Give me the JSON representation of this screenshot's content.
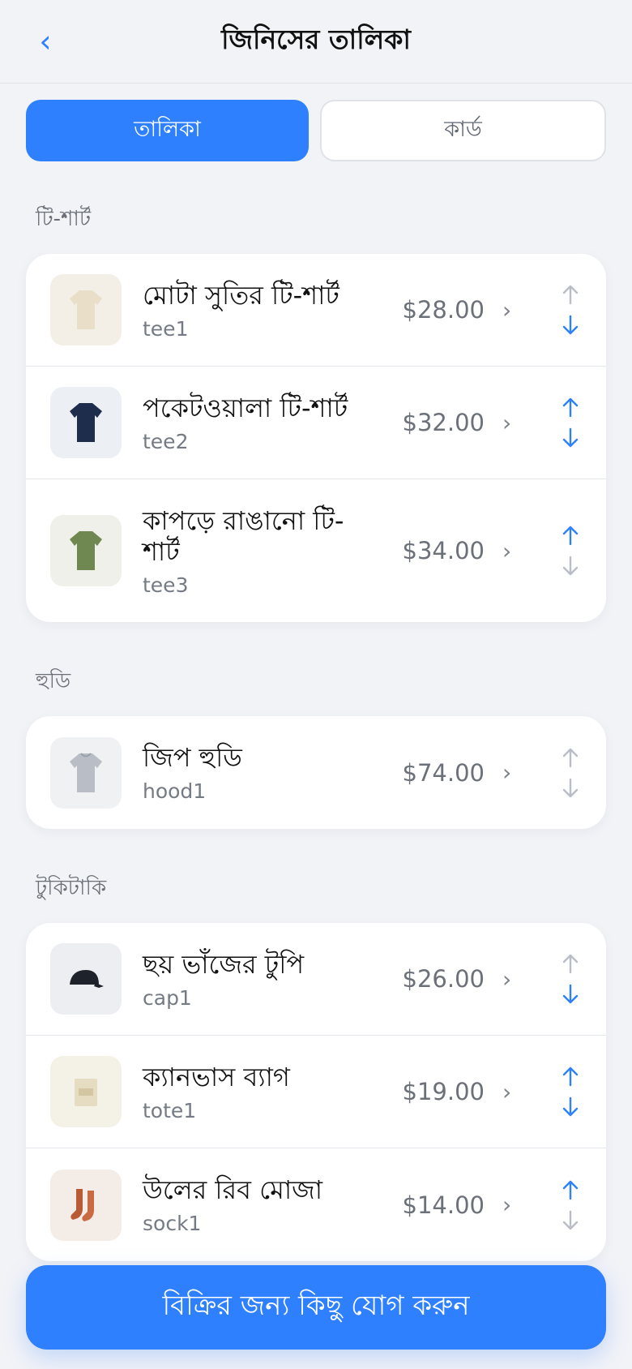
{
  "header": {
    "title": "জিনিসের তালিকা"
  },
  "segments": {
    "list": "তালিকা",
    "card": "কার্ড"
  },
  "sections": [
    {
      "title": "টি-শার্ট",
      "items": [
        {
          "name": "মোটা সুতির টি-শার্ট",
          "sku": "tee1",
          "price": "$28.00",
          "up_enabled": false,
          "down_enabled": true
        },
        {
          "name": "পকেটওয়ালা টি-শার্ট",
          "sku": "tee2",
          "price": "$32.00",
          "up_enabled": true,
          "down_enabled": true
        },
        {
          "name": "কাপড়ে রাঙানো টি-শার্ট",
          "sku": "tee3",
          "price": "$34.00",
          "up_enabled": true,
          "down_enabled": false
        }
      ]
    },
    {
      "title": "হুডি",
      "items": [
        {
          "name": "জিপ হুডি",
          "sku": "hood1",
          "price": "$74.00",
          "up_enabled": false,
          "down_enabled": false
        }
      ]
    },
    {
      "title": "টুকিটাকি",
      "items": [
        {
          "name": "ছয় ভাঁজের টুপি",
          "sku": "cap1",
          "price": "$26.00",
          "up_enabled": false,
          "down_enabled": true
        },
        {
          "name": "ক্যানভাস ব্যাগ",
          "sku": "tote1",
          "price": "$19.00",
          "up_enabled": true,
          "down_enabled": true
        },
        {
          "name": "উলের রিব মোজা",
          "sku": "sock1",
          "price": "$14.00",
          "up_enabled": true,
          "down_enabled": false
        }
      ]
    }
  ],
  "cta": {
    "label": "বিক্রির জন্য কিছু যোগ করুন"
  },
  "icons": {
    "back": "chevron-left-icon",
    "row_chevron": "chevron-right-icon",
    "up": "arrow-up-icon",
    "down": "arrow-down-icon"
  },
  "colors": {
    "accent": "#2f80ff",
    "disabled_arrow": "#b9bdc5",
    "background": "#f2f3f7"
  }
}
